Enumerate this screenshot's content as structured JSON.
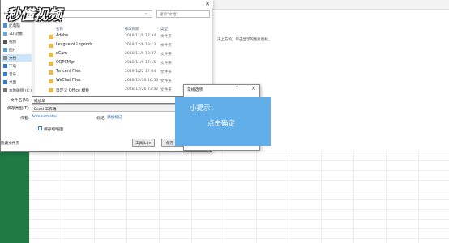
{
  "watermark": "秒懂视频",
  "background": {
    "hint_text": "决上方的，单击显示的图片图标。"
  },
  "save_dialog": {
    "address_crumbs": [
      "此电脑",
      "文档"
    ],
    "search_placeholder": "搜索\"文档\"",
    "column_headers": {
      "name": "名称",
      "date": "修改日期",
      "type": "类型"
    },
    "nav_items": [
      {
        "label": "此电脑",
        "icon": "computer-icon",
        "color": "#4a90d9"
      },
      {
        "label": "3D 对象",
        "icon": "cube-icon",
        "color": "#6aa9e0"
      },
      {
        "label": "视频",
        "icon": "video-icon",
        "color": "#555555"
      },
      {
        "label": "图片",
        "icon": "picture-icon",
        "color": "#5aa0d8"
      },
      {
        "label": "文档",
        "icon": "document-icon",
        "color": "#8a8a8a"
      },
      {
        "label": "下载",
        "icon": "download-icon",
        "color": "#2f7bd0"
      },
      {
        "label": "音乐",
        "icon": "music-icon",
        "color": "#2f7bd0"
      },
      {
        "label": "桌面",
        "icon": "desktop-icon",
        "color": "#2f7bd0"
      },
      {
        "label": "本地磁盘 (C:)",
        "icon": "disk-icon",
        "color": "#777777"
      }
    ],
    "selected_nav_index": 4,
    "files": [
      {
        "name": "Adobe",
        "date": "2018/11/9 17:34",
        "type": "文件夹"
      },
      {
        "name": "League of Legends",
        "date": "2018/12/6 19:13",
        "type": "文件夹"
      },
      {
        "name": "oCam",
        "date": "2018/11/9 18:37",
        "type": "文件夹"
      },
      {
        "name": "QQPCMgr",
        "date": "2018/11/9 17:15",
        "type": "文件夹"
      },
      {
        "name": "Tencent Files",
        "date": "2019/1/22 17:04",
        "type": "文件夹"
      },
      {
        "name": "WeChat Files",
        "date": "2018/12/30 16:53",
        "type": "文件夹"
      },
      {
        "name": "自定义 Office 模板",
        "date": "2018/12/26 23:42",
        "type": "文件夹"
      }
    ],
    "filename_label": "文件名(N):",
    "filename_value": "成绩单",
    "filetype_label": "保存类型(T):",
    "filetype_value": "Excel 工作簿",
    "author_label": "作者:",
    "author_value": "Administrator",
    "tags_label": "标记:",
    "tags_value": "添加标记",
    "thumbnail_label": "保存缩略图",
    "hide_folders_label": "隐藏文件夹",
    "tools_label": "工具(L) ▾",
    "save_label": "保存"
  },
  "web_options": {
    "title": "常规选项",
    "help": "?",
    "close": "×"
  },
  "tip": {
    "title": "小提示：",
    "body": "点击确定"
  }
}
